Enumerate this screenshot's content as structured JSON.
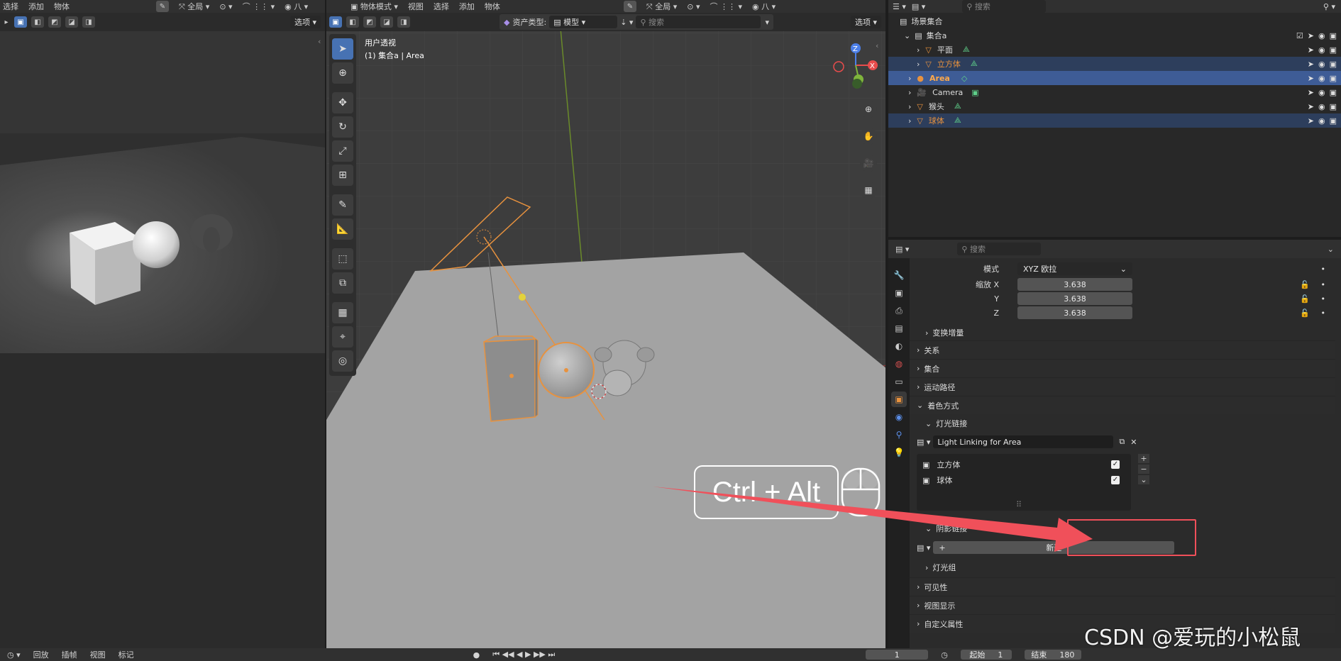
{
  "left_view": {
    "menu": [
      "选择",
      "添加",
      "物体"
    ],
    "global_label": "全局",
    "options_label": "选项"
  },
  "center_view": {
    "menu": [
      "物体模式",
      "视图",
      "选择",
      "添加",
      "物体"
    ],
    "global_label": "全局",
    "options_label": "选项",
    "asset_type_label": "资产类型:",
    "asset_type_value": "模型",
    "search_placeholder": "搜索",
    "view_name": "用户透视",
    "view_info": "(1) 集合a | Area",
    "shortcut_text": "Ctrl + Alt"
  },
  "outliner": {
    "search_placeholder": "搜索",
    "root": "场景集合",
    "collection": "集合a",
    "items": [
      {
        "label": "平面",
        "color": "#dddddd"
      },
      {
        "label": "立方体",
        "color": "#e8923e"
      },
      {
        "label": "Area",
        "color": "#e8923e"
      },
      {
        "label": "Camera",
        "color": "#dddddd"
      },
      {
        "label": "猴头",
        "color": "#dddddd"
      },
      {
        "label": "球体",
        "color": "#e8923e"
      }
    ]
  },
  "properties": {
    "search_placeholder": "搜索",
    "mode_label": "模式",
    "mode_value": "XYZ 欧拉",
    "scale_label": "缩放 X",
    "scale_y_label": "Y",
    "scale_z_label": "Z",
    "scale_x": "3.638",
    "scale_y": "3.638",
    "scale_z": "3.638",
    "delta_transform": "变换增量",
    "relations": "关系",
    "collections": "集合",
    "motion_paths": "运动路径",
    "shading": "着色方式",
    "light_linking": "灯光链接",
    "light_link_collection": "Light Linking for Area",
    "link_items": [
      "立方体",
      "球体"
    ],
    "shadow_linking": "阴影链接",
    "new_label": "新建",
    "light_group": "灯光组",
    "visibility": "可见性",
    "viewport_display": "视图显示",
    "custom_props": "自定义属性"
  },
  "timeline": {
    "menu": [
      "回放",
      "插帧",
      "视图",
      "标记"
    ],
    "frame": "1",
    "start_label": "起始",
    "start_value": "1",
    "end_label": "结束",
    "end_value": "180"
  },
  "watermark": "CSDN @爱玩的小松鼠",
  "colors": {
    "accent": "#4772b3",
    "selection_orange": "#e8923e",
    "annotation_red": "#f0505a"
  }
}
